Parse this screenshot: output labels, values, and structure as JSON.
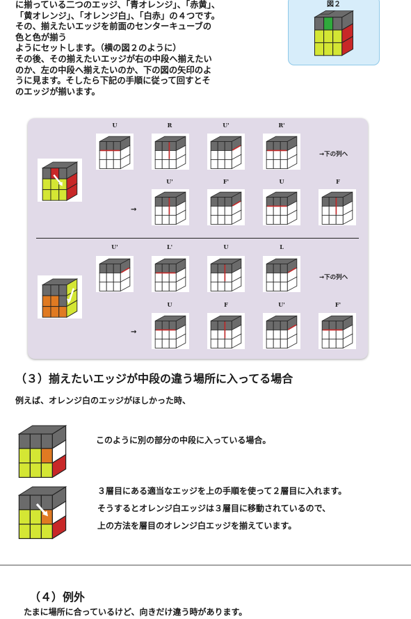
{
  "intro_lines": [
    "に揃っている二つのエッジ、「青オレンジ」、「赤黄」、",
    "「黄オレンジ」、「オレンジ白」、「白赤」の４つです。",
    "その、揃えたいエッジを前面のセンターキューブの",
    "色と色が揃う",
    "ようにセットします。（横の図２のように）",
    "その後、その揃えたいエッジが右の中段へ揃えたい",
    "のか、左の中段へ揃えたいのか、下の図の矢印のよ",
    "うに見ます。そしたら下記の手順に従って回すとそ",
    "のエッジが揃います。"
  ],
  "figure2": {
    "label": "図２"
  },
  "algorithms": {
    "right": {
      "row1_moves": [
        "U",
        "R",
        "U'",
        "R'"
      ],
      "row1_note": "→下の列へ",
      "row2_moves": [
        "U'",
        "F'",
        "U",
        "F"
      ],
      "row2_arrow": "→"
    },
    "left": {
      "row1_moves": [
        "U'",
        "L'",
        "U",
        "L"
      ],
      "row1_note": "→下の列へ",
      "row2_moves": [
        "U",
        "F",
        "U'",
        "F'"
      ],
      "row2_arrow": "→"
    }
  },
  "section3": {
    "heading": "（３）揃えたいエッジが中段の違う場所に入ってる場合",
    "example": "例えば、オレンジ白のエッジがほしかった時、",
    "desc1": "このように別の部分の中段に入っている場合。",
    "desc2_lines": [
      "３層目にある適当なエッジを上の手順を使って２層目に入れます。",
      "そうするとオレンジ白エッジは３層目に移動されているので、",
      "上の方法を層目のオレンジ白エッジを揃えています。"
    ]
  },
  "section4": {
    "heading": "（４）例外",
    "text": "たまに場所に合っているけど、向きだけ違う時があります。"
  },
  "colors": {
    "gray": "#6b6b6b",
    "green": "#2faa3c",
    "yellow": "#d4e634",
    "red": "#c82828",
    "orange": "#e07a22",
    "white": "#ffffff",
    "panel": "#e1dae8"
  }
}
